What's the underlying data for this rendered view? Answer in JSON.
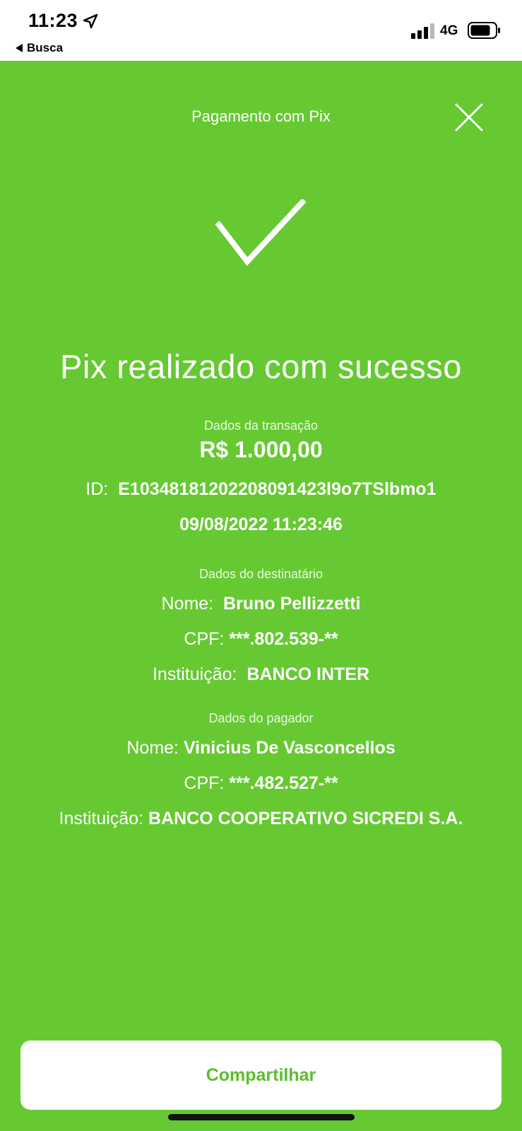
{
  "status_bar": {
    "time": "11:23",
    "back_label": "Busca",
    "network": "4G"
  },
  "header": {
    "title": "Pagamento com Pix"
  },
  "result": {
    "title": "Pix realizado com sucesso"
  },
  "transaction": {
    "section_label": "Dados da transação",
    "amount": "R$ 1.000,00",
    "id_label": "ID:",
    "id_value": "E10348181202208091423l9o7TSlbmo1",
    "datetime": "09/08/2022 11:23:46"
  },
  "recipient": {
    "section_label": "Dados do destinatário",
    "name_label": "Nome:",
    "name_value": "Bruno Pellizzetti",
    "cpf_label": "CPF:",
    "cpf_value": "***.802.539-**",
    "institution_label": "Instituição:",
    "institution_value": "BANCO INTER"
  },
  "payer": {
    "section_label": "Dados do pagador",
    "name_label": "Nome:",
    "name_value": "Vinicius De Vasconcellos",
    "cpf_label": "CPF:",
    "cpf_value": "***.482.527-**",
    "institution_label": "Instituição:",
    "institution_value": "BANCO COOPERATIVO SICREDI S.A."
  },
  "actions": {
    "share_label": "Compartilhar"
  },
  "colors": {
    "background": "#66c932",
    "button_text": "#5bbd2d",
    "text": "#ffffff"
  },
  "icons": {
    "location": "location-arrow-icon",
    "back": "back-arrow-icon",
    "signal": "cellular-signal-icon",
    "battery": "battery-icon",
    "close": "close-icon",
    "success": "checkmark-icon"
  }
}
